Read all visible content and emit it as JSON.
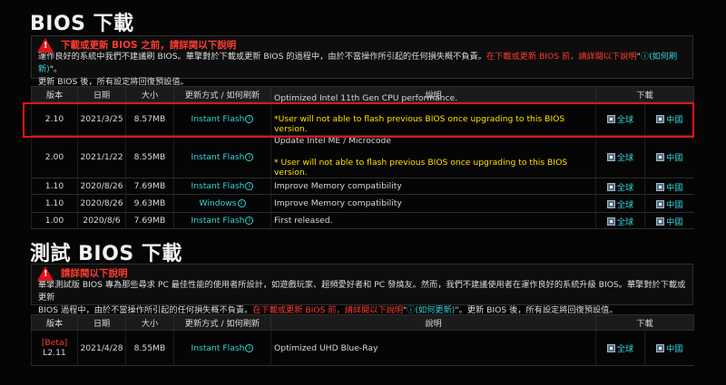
{
  "sections": {
    "bios_title": "BIOS 下載",
    "beta_title": "測試 BIOS 下載"
  },
  "warning1": {
    "title": "下載或更新 BIOS 之前，請詳閱以下說明",
    "line1": "運作良好的系統中我們不建議刷 BIOS。華擎對於下載或更新 BIOS 的過程中，由於不當操作所引起的任何損失概不負責。",
    "line1_red": "在下載或更新 BIOS 前，請詳閱以下說明",
    "line1_quote_open": "\"",
    "line1_info": "ⓘ",
    "line1_cyan": "(如何刷新)",
    "line1_quote_close": "\"。",
    "line2": "更新 BIOS 後，所有設定將回復預設值。"
  },
  "warning2": {
    "title": "請詳閱以下說明",
    "line1": "華擎測試版 BIOS 專為那些尋求 PC 最佳性能的使用者所設計，如遊戲玩家、超頻愛好者和 PC 發燒友。然而，我們不建議使用者在運作良好的系統升級 BIOS。華擎對於下載或更新",
    "line2a": "BIOS 過程中，由於不當操作所引起的任何損失概不負責。",
    "line2_red": "在下載或更新 BIOS 前，請詳閱以下說明",
    "line2_quote_open": "\"",
    "line2_info": "ⓘ",
    "line2_cyan": "(如何更新)",
    "line2_quote_close": "\"。",
    "line2b": "更新 BIOS 後，所有設定將回復預設值。"
  },
  "table_headers": {
    "version": "版本",
    "date": "日期",
    "size": "大小",
    "method": "更新方式 / 如何刷新",
    "description": "說明",
    "download": "下載"
  },
  "bios_rows": [
    {
      "version": "2.10",
      "date": "2021/3/25",
      "size": "8.57MB",
      "method": "Instant Flash",
      "desc1": "Optimized Intel 11th Gen CPU performance.",
      "desc2": "*User will not able to flash previous BIOS once upgrading to this BIOS version.",
      "dl1": "全球",
      "dl2": "中國"
    },
    {
      "version": "2.00",
      "date": "2021/1/22",
      "size": "8.55MB",
      "method": "Instant Flash",
      "desc1": "Update Intel ME / Microcode",
      "desc2": "* User will not able to flash previous BIOS once upgrading to this BIOS version.",
      "dl1": "全球",
      "dl2": "中國"
    },
    {
      "version": "1.10",
      "date": "2020/8/26",
      "size": "7.69MB",
      "method": "Instant Flash",
      "desc1": "Improve Memory compatibility",
      "desc2": "",
      "dl1": "全球",
      "dl2": "中國"
    },
    {
      "version": "1.10",
      "date": "2020/8/26",
      "size": "9.63MB",
      "method": "Windows",
      "desc1": "Improve Memory compatibility",
      "desc2": "",
      "dl1": "全球",
      "dl2": "中國"
    },
    {
      "version": "1.00",
      "date": "2020/8/6",
      "size": "7.69MB",
      "method": "Instant Flash",
      "desc1": "First released.",
      "desc2": "",
      "dl1": "全球",
      "dl2": "中國"
    }
  ],
  "beta_rows": [
    {
      "tag": "[Beta]",
      "version": "L2.11",
      "date": "2021/4/28",
      "size": "8.55MB",
      "method": "Instant Flash",
      "desc1": "Optimized UHD Blue-Ray",
      "dl1": "全球",
      "dl2": "中國"
    }
  ],
  "colors": {
    "accent_cyan": "#30d5d8",
    "warning_red": "#ff3b30",
    "note_yellow": "#ffe000",
    "highlight_red": "#e0141b"
  },
  "icons": {
    "warning": "warning-triangle-icon",
    "info": "info-circle-icon",
    "download": "download-box-icon"
  }
}
